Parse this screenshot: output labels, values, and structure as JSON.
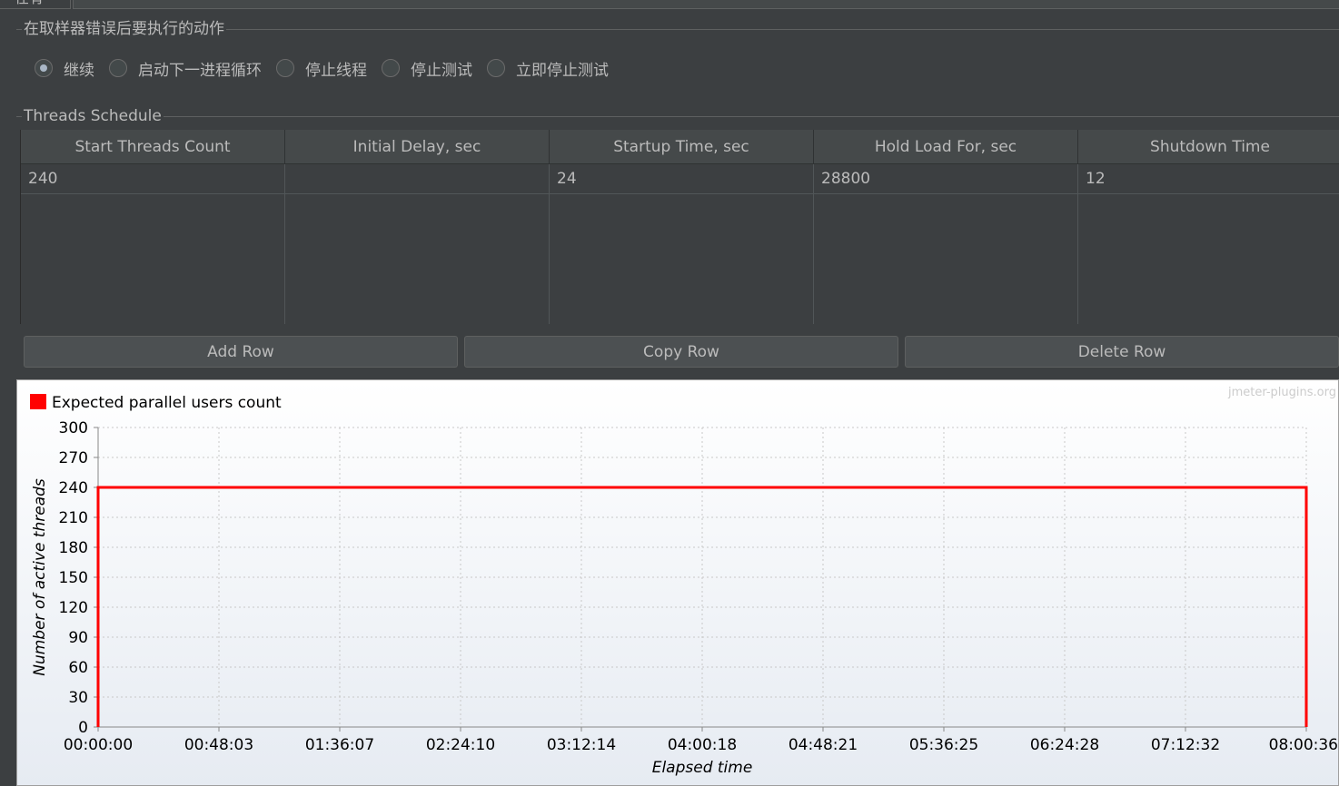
{
  "top_tab": {
    "label": "在有"
  },
  "error_action": {
    "title": "在取样器错误后要执行的动作",
    "options": [
      {
        "label": "继续",
        "selected": true
      },
      {
        "label": "启动下一进程循环",
        "selected": false
      },
      {
        "label": "停止线程",
        "selected": false
      },
      {
        "label": "停止测试",
        "selected": false
      },
      {
        "label": "立即停止测试",
        "selected": false
      }
    ]
  },
  "schedule": {
    "title": "Threads Schedule",
    "columns": [
      "Start Threads Count",
      "Initial Delay, sec",
      "Startup Time, sec",
      "Hold Load For, sec",
      "Shutdown Time"
    ],
    "rows": [
      [
        "240",
        "",
        "24",
        "28800",
        "12"
      ]
    ]
  },
  "buttons": {
    "add_row": "Add Row",
    "copy_row": "Copy Row",
    "delete_row": "Delete Row"
  },
  "watermark": "jmeter-plugins.org",
  "colors": {
    "series": "#ff0000",
    "background": "#3c3f41"
  },
  "chart_data": {
    "type": "line",
    "legend": [
      "Expected parallel users count"
    ],
    "xlabel": "Elapsed time",
    "ylabel": "Number of active threads",
    "ylim": [
      0,
      300
    ],
    "yticks": [
      0,
      30,
      60,
      90,
      120,
      150,
      180,
      210,
      240,
      270,
      300
    ],
    "xticks": [
      "00:00:00",
      "00:48:03",
      "01:36:07",
      "02:24:10",
      "03:12:14",
      "04:00:18",
      "04:48:21",
      "05:36:25",
      "06:24:28",
      "07:12:32",
      "08:00:36"
    ],
    "xlim": [
      0,
      28836
    ],
    "grid": true,
    "series": [
      {
        "name": "Expected parallel users count",
        "x": [
          "00:00:00",
          "00:00:00",
          "08:00:36",
          "08:00:36"
        ],
        "values": [
          0,
          240,
          240,
          0
        ]
      }
    ]
  }
}
